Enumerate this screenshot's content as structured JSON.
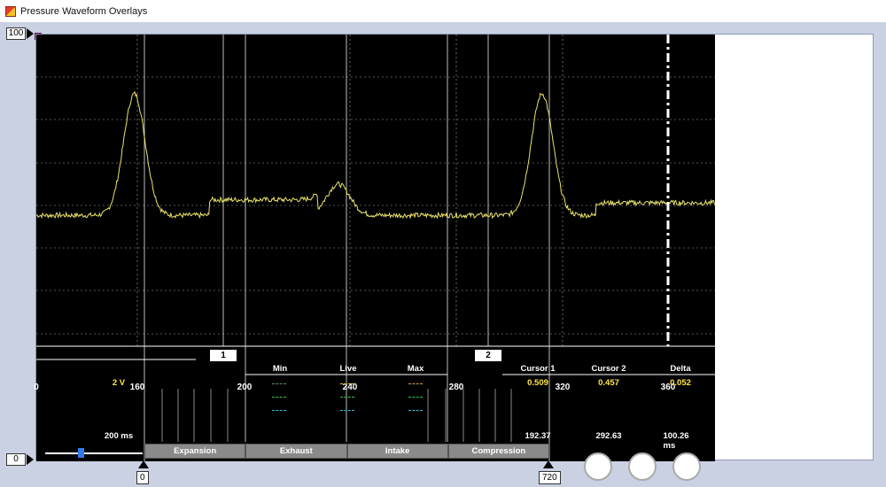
{
  "window": {
    "title": "Pressure Waveform Overlays"
  },
  "y_axis": {
    "max_label": "100",
    "min_label": "0"
  },
  "x_axis": {
    "start_label": "0",
    "end_label": "720",
    "ticks": [
      "0",
      "160",
      "200",
      "240",
      "280",
      "320",
      "360"
    ]
  },
  "cursors": {
    "cursor1_marker": "1",
    "cursor2_marker": "2"
  },
  "stats": {
    "scale": "2 V",
    "timebase": "200 ms",
    "headers": {
      "min": "Min",
      "live": "Live",
      "max": "Max",
      "cursor1": "Cursor 1",
      "cursor2": "Cursor 2",
      "delta": "Delta"
    },
    "cursor1_value": "0.509",
    "cursor2_value": "0.457",
    "delta_value": "0.052",
    "cursor1_time": "192.37",
    "cursor2_time": "292.63",
    "delta_time": "100.26 ms"
  },
  "phases": [
    "Expansion",
    "Exhaust",
    "Intake",
    "Compression"
  ],
  "colors": {
    "trace": "#e9e36a",
    "accent": "#ffe640",
    "min_line": "#6a8a6a",
    "live_line": "#e8c03a",
    "max_line": "#c9a24a",
    "green": "#3fbf55",
    "cyan": "#3fb8d8"
  },
  "chart_data": {
    "type": "line",
    "xlabel": "",
    "ylabel": "",
    "ylim": [
      0,
      100
    ],
    "x_visible_range": [
      123,
      386
    ],
    "peaks": [
      {
        "x": 161,
        "y": 81
      },
      {
        "x": 240,
        "y": 52
      },
      {
        "x": 319,
        "y": 81
      }
    ],
    "baseline_y": 42
  }
}
